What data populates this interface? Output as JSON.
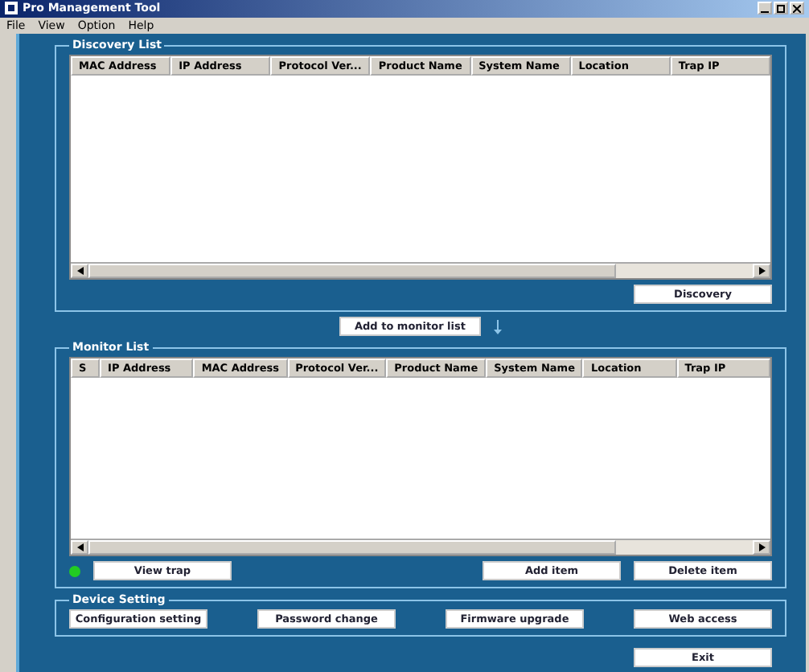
{
  "window": {
    "title": "Pro Management Tool"
  },
  "menu": [
    "File",
    "View",
    "Option",
    "Help"
  ],
  "discovery": {
    "title": "Discovery List",
    "columns": [
      "MAC Address",
      "IP Address",
      "Protocol Ver...",
      "Product Name",
      "System Name",
      "Location",
      "Trap IP"
    ],
    "button": "Discovery"
  },
  "add_button": "Add to monitor list",
  "monitor": {
    "title": "Monitor List",
    "columns": [
      "S",
      "IP Address",
      "MAC Address",
      "Protocol Ver...",
      "Product Name",
      "System Name",
      "Location",
      "Trap IP"
    ],
    "status": {
      "color": "#22cc22"
    },
    "buttons": [
      "View trap",
      "Add item",
      "Delete item"
    ]
  },
  "device_setting": {
    "title": "Device Setting",
    "buttons": [
      "Configuration setting",
      "Password change",
      "Firmware upgrade",
      "Web access"
    ]
  },
  "exit_button": "Exit"
}
